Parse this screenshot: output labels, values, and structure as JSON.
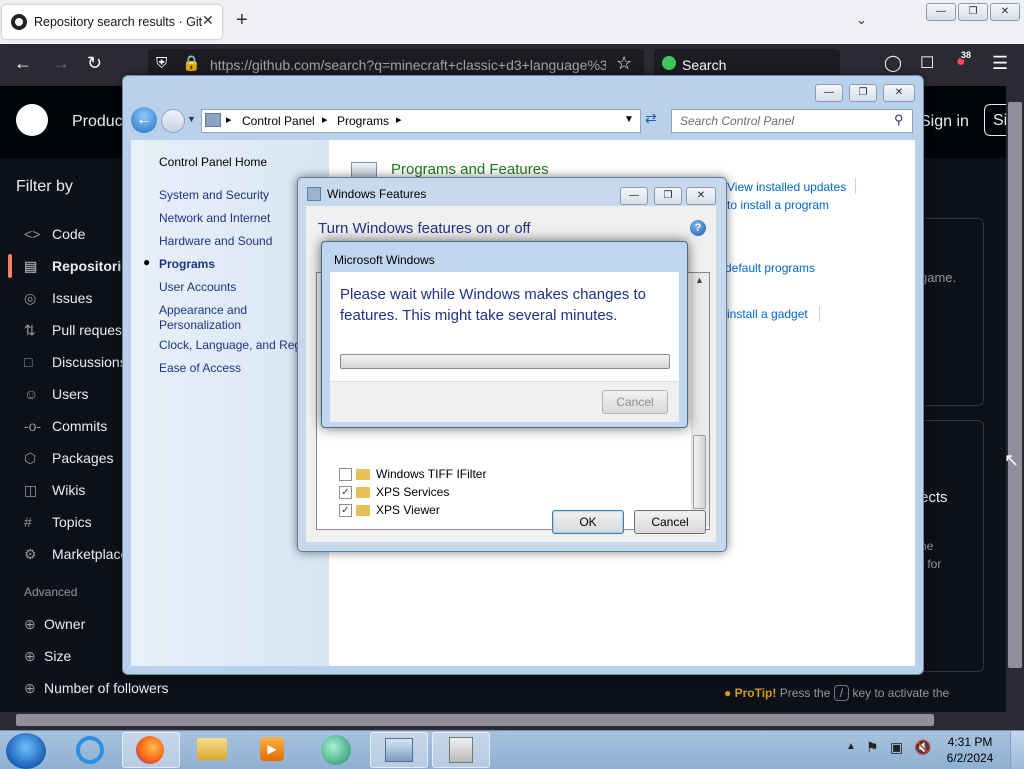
{
  "browser": {
    "tab_title": "Repository search results · GitHub",
    "url": "https://github.com/search?q=minecraft+classic+d3+language%3",
    "search_label": "Search",
    "extension_badge": "38"
  },
  "github": {
    "product_label": "Produc",
    "signin_label": "Sign in",
    "signup_label": "Si",
    "filter_by": "Filter by",
    "filters": [
      "Code",
      "Repositories",
      "Issues",
      "Pull requests",
      "Discussions",
      "Users",
      "Commits",
      "Packages",
      "Wikis",
      "Topics",
      "Marketplace"
    ],
    "advanced_label": "Advanced",
    "advanced_items": [
      "Owner",
      "Size",
      "Number of followers"
    ],
    "right_text_1": "game.",
    "right_text_2": "ects",
    "right_text_3": "ne",
    "right_text_4": "r for",
    "protip_label": "ProTip!",
    "protip_text_1": "Press the",
    "protip_key": "/",
    "protip_text_2": "key to activate the"
  },
  "control_panel": {
    "breadcrumb_1": "Control Panel",
    "breadcrumb_2": "Programs",
    "search_placeholder": "Search Control Panel",
    "home": "Control Panel Home",
    "links": [
      "System and Security",
      "Network and Internet",
      "Hardware and Sound",
      "Programs",
      "User Accounts",
      "Appearance and Personalization",
      "Clock, Language, and Reg",
      "Ease of Access"
    ],
    "heading": "Programs and Features",
    "link_updates": "View installed updates",
    "link_install": "to install a program",
    "link_default": "default programs",
    "link_gadget": "install a gadget"
  },
  "windows_features": {
    "title": "Windows Features",
    "heading": "Turn Windows features on or off",
    "items": [
      {
        "label": "Windows TIFF IFilter",
        "checked": false
      },
      {
        "label": "XPS Services",
        "checked": true
      },
      {
        "label": "XPS Viewer",
        "checked": true
      }
    ],
    "ok": "OK",
    "cancel": "Cancel"
  },
  "progress_dialog": {
    "title": "Microsoft Windows",
    "message": "Please wait while Windows makes changes to features. This might take several minutes.",
    "progress": 0,
    "cancel": "Cancel"
  },
  "taskbar": {
    "time": "4:31 PM",
    "date": "6/2/2024"
  }
}
